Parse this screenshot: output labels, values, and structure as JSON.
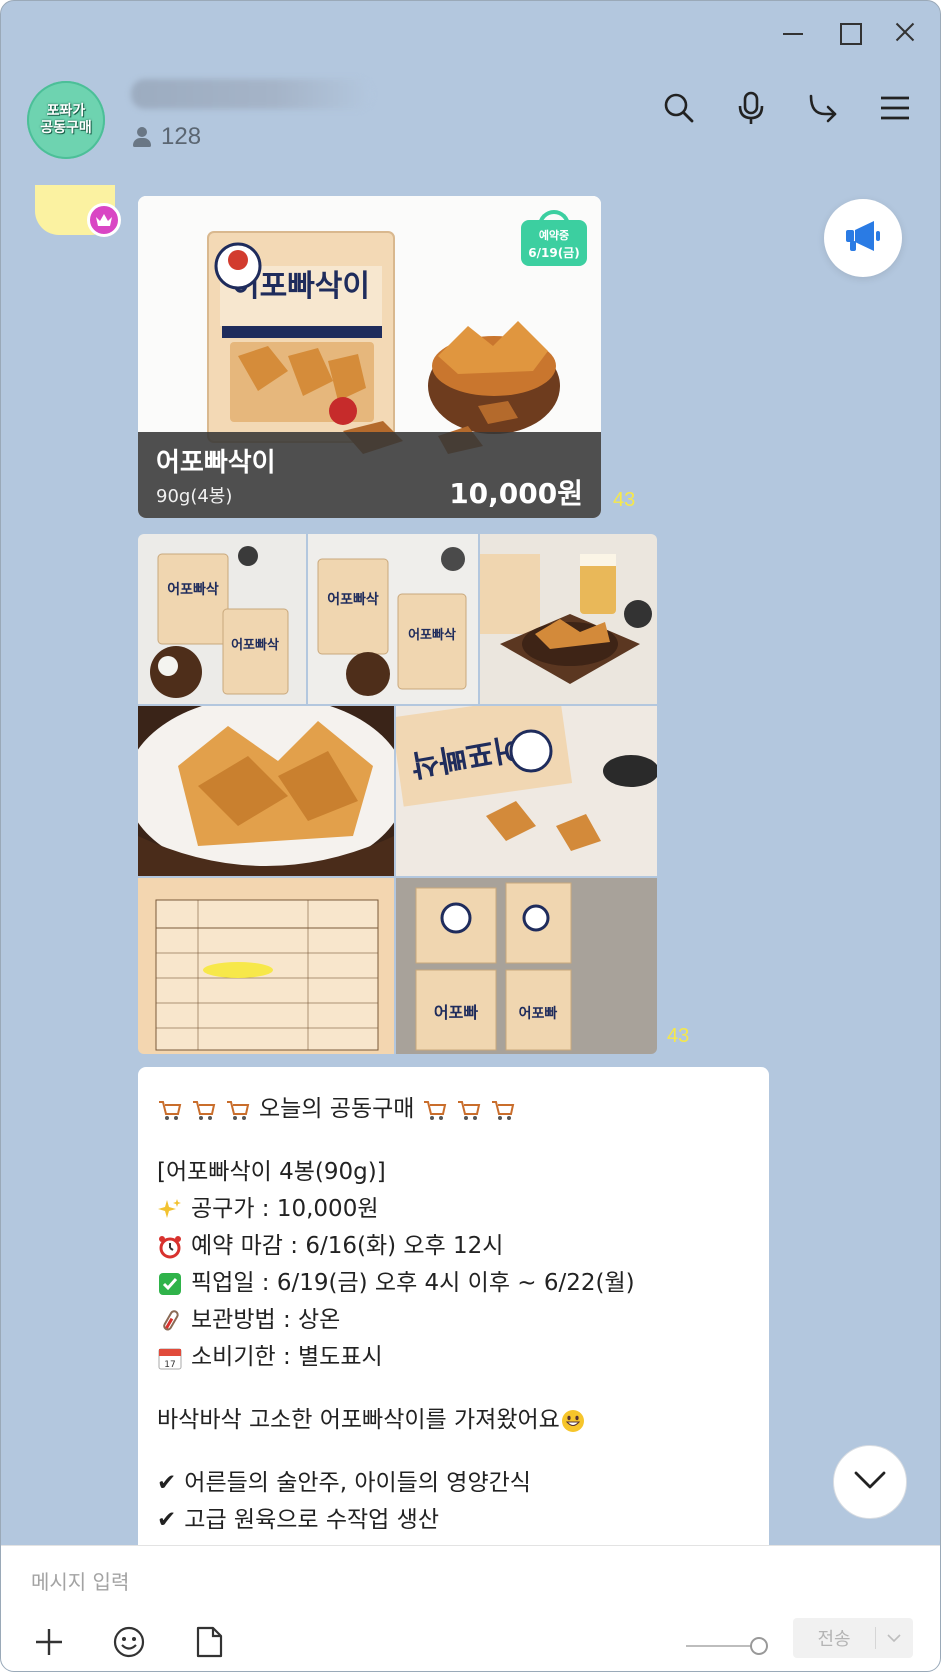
{
  "window": {
    "controls": [
      "minimize",
      "maximize",
      "close"
    ]
  },
  "header": {
    "avatar_line1": "포퐈가",
    "avatar_line2": "공동구매",
    "member_count": "128",
    "icons": [
      "search-icon",
      "microphone-icon",
      "share-icon",
      "menu-icon"
    ]
  },
  "product_card": {
    "name": "어포빠삭이",
    "weight": "90g(4봉)",
    "price": "10,000원",
    "badge_line1": "예약중",
    "badge_line2": "6/19(금)",
    "read_count": "43",
    "accent": "#3ccfa0"
  },
  "photo_grid": {
    "read_count": "43",
    "photos": [
      "snack-packs-overhead",
      "snack-packs-plate",
      "snack-with-beer",
      "snack-basket-closeup",
      "snack-pack-dip",
      "nutrition-label",
      "boxed-packs"
    ]
  },
  "message": {
    "line_header_text": "오늘의 공동구매",
    "line_product": "[어포빠삭이 4봉(90g)]",
    "line_price": "공구가 : 10,000원",
    "line_deadline": "예약 마감 : 6/16(화) 오후 12시",
    "line_pickup": "픽업일 : 6/19(금) 오후 4시 이후 ~ 6/22(월)",
    "line_storage": "보관방법 : 상온",
    "line_expiry": "소비기한 : 별도표시",
    "line_intro": "바삭바삭 고소한 어포빠삭이를 가져왔어요",
    "line_point1": "어른들의 술안주, 아이들의 영양간식",
    "line_point2": "고급 원육으로 수작업 생산",
    "checkmark": "✔"
  },
  "input": {
    "placeholder": "메시지 입력",
    "send_label": "전송"
  }
}
